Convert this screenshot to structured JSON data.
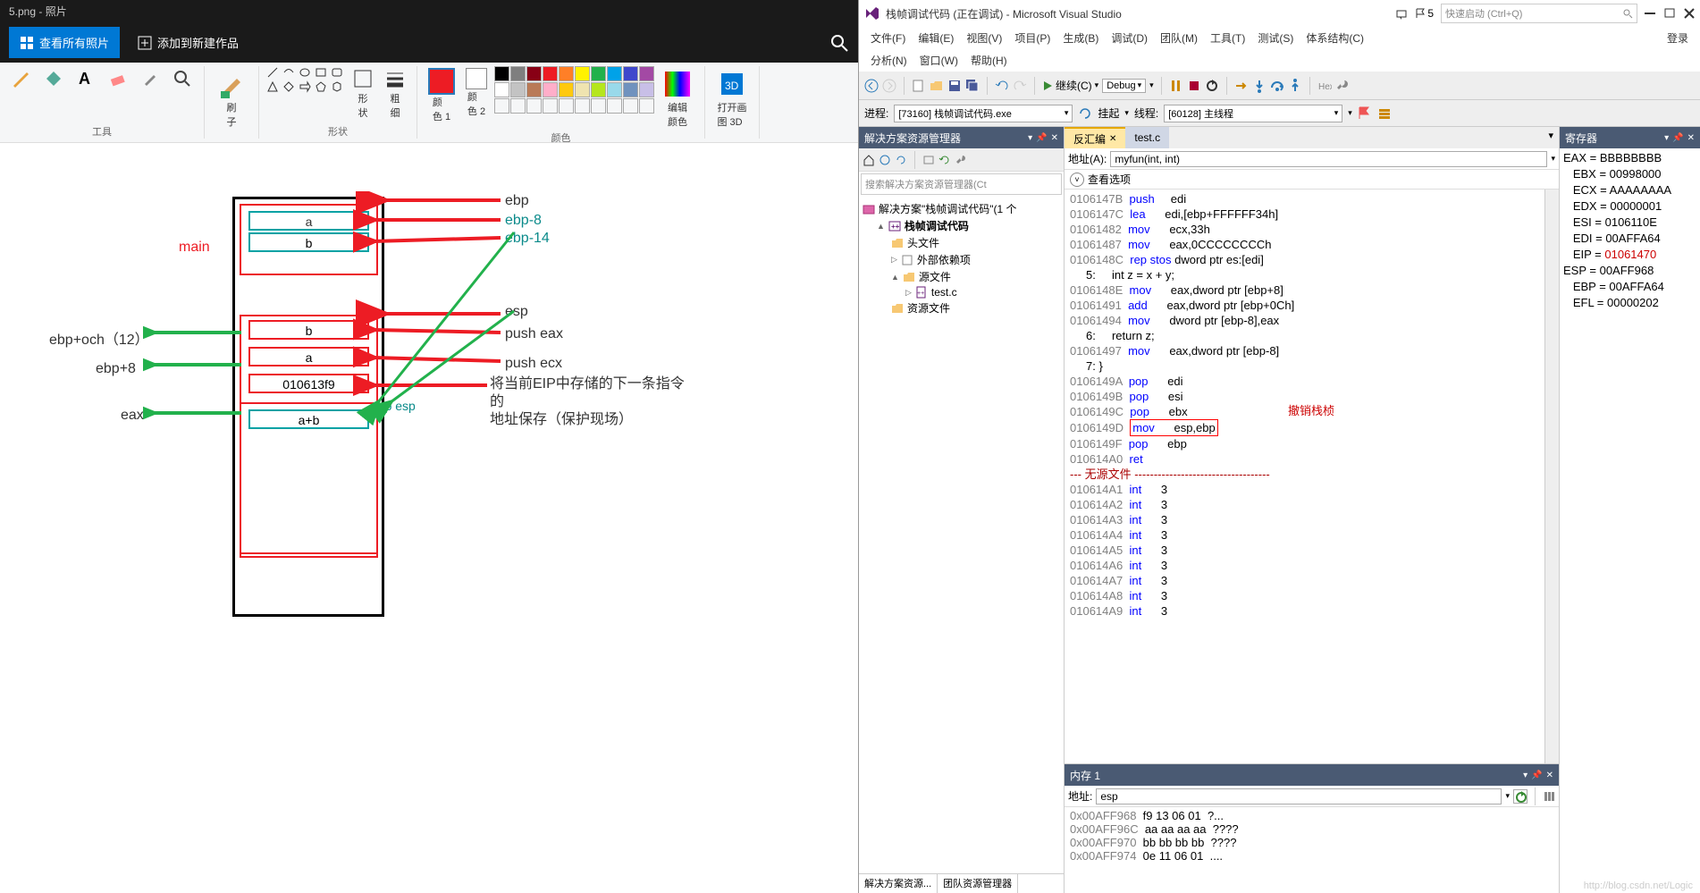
{
  "photos": {
    "title": "5.png - 照片",
    "view_all": "查看所有照片",
    "add_to": "添加到新建作品"
  },
  "ribbon": {
    "tools": "工具",
    "brush": "刷\n子",
    "shape_label": "形状",
    "shape": "形\n状",
    "thickness": "粗\n细",
    "color1": "颜\n色 1",
    "color2": "颜\n色 2",
    "colors_label": "颜色",
    "edit_colors": "编辑\n颜色",
    "paint3d": "打开画\n图 3D"
  },
  "diagram": {
    "main": "main",
    "a": "a",
    "b": "b",
    "ab": "a+b",
    "addr": "010613f9",
    "ebp": "ebp",
    "ebp8": "ebp-8",
    "ebp14": "ebp-14",
    "esp": "esp",
    "push_eax": "push eax",
    "push_ecx": "push ecx",
    "eip_note": "将当前EIP中存储的下一条指令的\n地址保存（保护现场）",
    "ebp_esp": "ebp esp",
    "lbl_ebp_och": "ebp+och（12）",
    "lbl_ebp8": "ebp+8",
    "lbl_eax": "eax"
  },
  "vs": {
    "title": "栈帧调试代码 (正在调试) - Microsoft Visual Studio",
    "flag_count": "5",
    "quicklaunch": "快速启动 (Ctrl+Q)",
    "login": "登录",
    "menu": {
      "file": "文件(F)",
      "edit": "编辑(E)",
      "view": "视图(V)",
      "project": "项目(P)",
      "build": "生成(B)",
      "debug": "调试(D)",
      "team": "团队(M)",
      "tools": "工具(T)",
      "test": "测试(S)",
      "arch": "体系结构(C)",
      "analyze": "分析(N)",
      "window": "窗口(W)",
      "help": "帮助(H)"
    },
    "toolbar": {
      "continue": "继续(C)",
      "debug_cfg": "Debug"
    },
    "toolbar2": {
      "process": "进程:",
      "process_val": "[73160] 栈帧调试代码.exe",
      "suspend": "挂起",
      "thread": "线程:",
      "thread_val": "[60128] 主线程"
    },
    "solution": {
      "header": "解决方案资源管理器",
      "search_ph": "搜索解决方案资源管理器(Ct",
      "root": "解决方案\"栈帧调试代码\"(1 个",
      "proj": "栈帧调试代码",
      "headers": "头文件",
      "external": "外部依赖项",
      "sources": "源文件",
      "testc": "test.c",
      "resources": "资源文件",
      "tab1": "解决方案资源...",
      "tab2": "团队资源管理器"
    },
    "disasm": {
      "tab": "反汇编",
      "tab2": "test.c",
      "addr_label": "地址(A):",
      "addr_val": "myfun(int, int)",
      "view_opts": "查看选项",
      "annotation": "撤销栈桢"
    },
    "asm_lines": [
      {
        "a": "0106147B",
        "op": "push",
        "arg": "edi"
      },
      {
        "a": "0106147C",
        "op": "lea",
        "arg": "edi,[ebp+FFFFFF34h]"
      },
      {
        "a": "01061482",
        "op": "mov",
        "arg": "ecx,33h"
      },
      {
        "a": "01061487",
        "op": "mov",
        "arg": "eax,0CCCCCCCCh"
      },
      {
        "a": "0106148C",
        "op": "rep stos",
        "arg": "dword ptr es:[edi]"
      },
      {
        "src": "     5:     int z = x + y;"
      },
      {
        "a": "0106148E",
        "op": "mov",
        "arg": "eax,dword ptr [ebp+8]"
      },
      {
        "a": "01061491",
        "op": "add",
        "arg": "eax,dword ptr [ebp+0Ch]"
      },
      {
        "a": "01061494",
        "op": "mov",
        "arg": "dword ptr [ebp-8],eax"
      },
      {
        "src": "     6:     return z;"
      },
      {
        "a": "01061497",
        "op": "mov",
        "arg": "eax,dword ptr [ebp-8]"
      },
      {
        "src": "     7: }"
      },
      {
        "a": "0106149A",
        "op": "pop",
        "arg": "edi"
      },
      {
        "a": "0106149B",
        "op": "pop",
        "arg": "esi"
      },
      {
        "a": "0106149C",
        "op": "pop",
        "arg": "ebx"
      },
      {
        "a": "0106149D",
        "op": "mov",
        "arg": "esp,ebp",
        "hl": true
      },
      {
        "a": "0106149F",
        "op": "pop",
        "arg": "ebp"
      },
      {
        "a": "010614A0",
        "op": "ret",
        "arg": ""
      },
      {
        "nosrc": "--- 无源文件 -----------------------------------"
      },
      {
        "a": "010614A1",
        "op": "int",
        "arg": "3"
      },
      {
        "a": "010614A2",
        "op": "int",
        "arg": "3"
      },
      {
        "a": "010614A3",
        "op": "int",
        "arg": "3"
      },
      {
        "a": "010614A4",
        "op": "int",
        "arg": "3"
      },
      {
        "a": "010614A5",
        "op": "int",
        "arg": "3"
      },
      {
        "a": "010614A6",
        "op": "int",
        "arg": "3"
      },
      {
        "a": "010614A7",
        "op": "int",
        "arg": "3"
      },
      {
        "a": "010614A8",
        "op": "int",
        "arg": "3"
      },
      {
        "a": "010614A9",
        "op": "int",
        "arg": "3"
      }
    ],
    "memory": {
      "header": "内存 1",
      "addr_label": "地址:",
      "addr_val": "esp",
      "lines": [
        {
          "a": "0x00AFF968",
          "h": "f9 13 06 01",
          "c": "?..."
        },
        {
          "a": "0x00AFF96C",
          "h": "aa aa aa aa",
          "c": "????"
        },
        {
          "a": "0x00AFF970",
          "h": "bb bb bb bb",
          "c": "????"
        },
        {
          "a": "0x00AFF974",
          "h": "0e 11 06 01",
          "c": "...."
        }
      ]
    },
    "registers": {
      "header": "寄存器",
      "regs": [
        {
          "n": "EAX",
          "v": "BBBBBBBB",
          "i": 0
        },
        {
          "n": "EBX",
          "v": "00998000"
        },
        {
          "n": "ECX",
          "v": "AAAAAAAA"
        },
        {
          "n": "EDX",
          "v": "00000001"
        },
        {
          "n": "ESI",
          "v": "0106110E"
        },
        {
          "n": "EDI",
          "v": "00AFFA64"
        },
        {
          "n": "EIP",
          "v": "01061470",
          "red": true
        },
        {
          "n": "ESP",
          "v": "00AFF968",
          "i": 0
        },
        {
          "n": "EBP",
          "v": "00AFFA64"
        },
        {
          "n": "EFL",
          "v": "00000202"
        }
      ]
    }
  }
}
